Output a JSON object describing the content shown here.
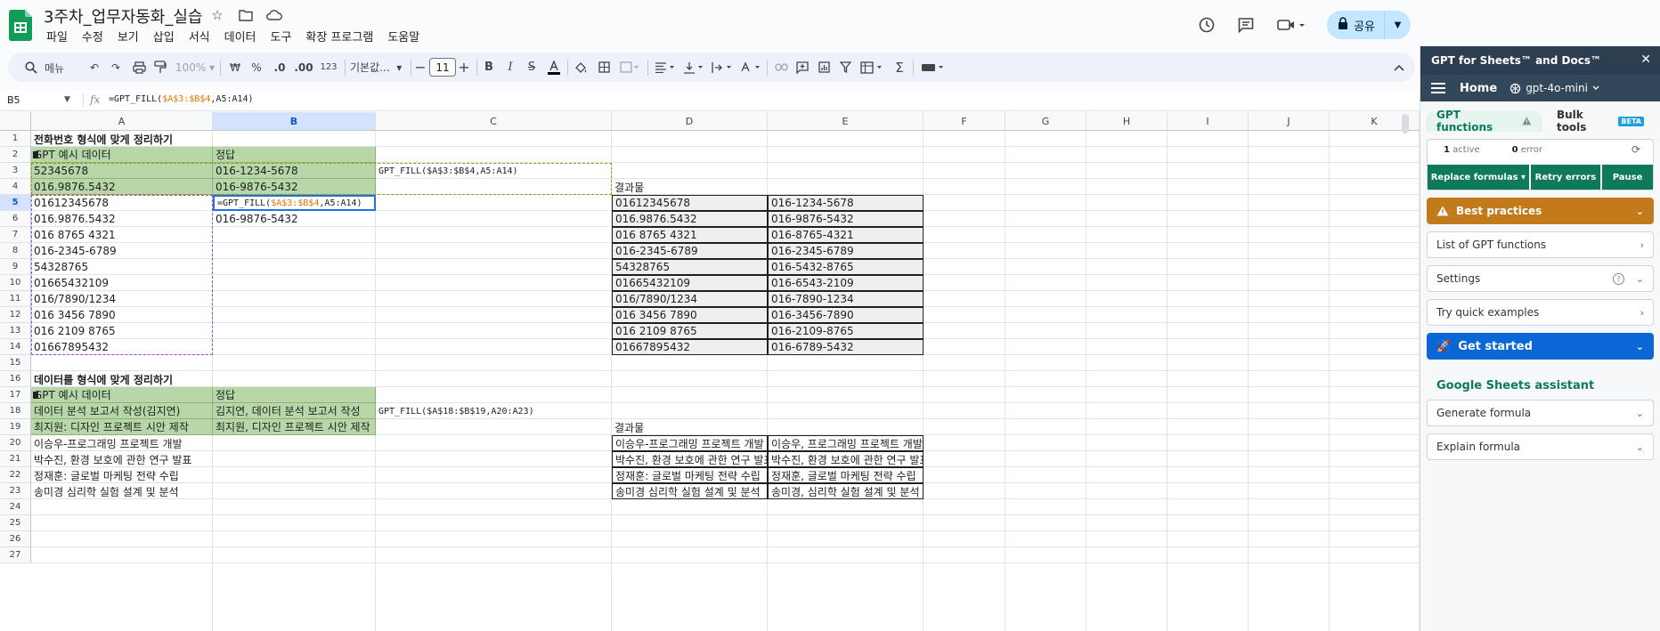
{
  "doc": {
    "title": "3주차_업무자동화_실습"
  },
  "menu": [
    "파일",
    "수정",
    "보기",
    "삽입",
    "서식",
    "데이터",
    "도구",
    "확장 프로그램",
    "도움말"
  ],
  "share": {
    "label": "공유"
  },
  "toolbar": {
    "menu_search": "메뉴",
    "zoom": "100%",
    "currency": "₩",
    "percent": "%",
    "dec_less": ".0",
    "dec_more": ".00",
    "num_format": "123",
    "font": "기본값...",
    "font_size": "11"
  },
  "formula_bar": {
    "cell_ref": "B5",
    "formula_prefix": "=GPT_FILL(",
    "formula_ref": "$A$3:$B$4",
    "formula_suffix": ",A5:A14)"
  },
  "columns": [
    "A",
    "B",
    "C",
    "D",
    "E",
    "F",
    "G",
    "H",
    "I",
    "J",
    "K"
  ],
  "rows": [
    "1",
    "2",
    "3",
    "4",
    "5",
    "6",
    "7",
    "8",
    "9",
    "10",
    "11",
    "12",
    "13",
    "14",
    "15",
    "16",
    "17",
    "18",
    "19",
    "20",
    "21",
    "22",
    "23",
    "24",
    "25",
    "26",
    "27"
  ],
  "section1": {
    "heading": "전화번호 형식에 맞게 정리하기",
    "col_a_header": "GPT 예시 데이터",
    "col_b_header": "정답",
    "examples": [
      [
        "52345678",
        "016-1234-5678"
      ],
      [
        "016.9876.5432",
        "016-9876-5432"
      ]
    ],
    "inputs": [
      "01612345678",
      "016.9876.5432",
      "016 8765 4321",
      "016-2345-6789",
      "54328765",
      "01665432109",
      "016/7890/1234",
      "016 3456 7890",
      "016 2109 8765",
      "01667895432"
    ],
    "b5_prefix": "=GPT_FILL(",
    "b5_ref": "$A$3:$B$4",
    "b5_suffix": ",A5:A14)",
    "b6": "016-9876-5432",
    "copied_formula": "GPT_FILL($A$3:$B$4,A5:A14)",
    "result_label": "결과물",
    "results": [
      [
        "01612345678",
        "016-1234-5678"
      ],
      [
        "016.9876.5432",
        "016-9876-5432"
      ],
      [
        "016 8765 4321",
        "016-8765-4321"
      ],
      [
        "016-2345-6789",
        "016-2345-6789"
      ],
      [
        "54328765",
        "016-5432-8765"
      ],
      [
        "01665432109",
        "016-6543-2109"
      ],
      [
        "016/7890/1234",
        "016-7890-1234"
      ],
      [
        "016 3456 7890",
        "016-3456-7890"
      ],
      [
        "016 2109 8765",
        "016-2109-8765"
      ],
      [
        "01667895432",
        "016-6789-5432"
      ]
    ]
  },
  "section2": {
    "heading": "데이터를 형식에 맞게 정리하기",
    "col_a_header": "GPT 예시 데이터",
    "col_b_header": "정답",
    "examples": [
      [
        "데이터 분석 보고서 작성(김지연)",
        "김지연, 데이터 분석 보고서 작성"
      ],
      [
        "최지원: 디자인 프로젝트 시안 제작",
        "최지원, 디자인 프로젝트 시안 제작"
      ]
    ],
    "inputs": [
      "이승우-프로그래밍 프로젝트 개발",
      "박수진, 환경 보호에 관한 연구 발표",
      "정재훈: 글로벌 마케팅 전략 수립",
      "송미경 심리학 실험 설계 및 분석"
    ],
    "copied_formula": "GPT_FILL($A$18:$B$19,A20:A23)",
    "result_label": "결과물",
    "results": [
      [
        "이승우-프로그래밍 프로젝트 개발",
        "이승우, 프로그래밍 프로젝트 개발"
      ],
      [
        "박수진, 환경 보호에 관한 연구 발표",
        "박수진, 환경 보호에 관한 연구 발표"
      ],
      [
        "정재훈: 글로벌 마케팅 전략 수립",
        "정재훈, 글로벌 마케팅 전략 수립"
      ],
      [
        "송미경 심리학 실험 설계 및 분석",
        "송미경, 심리학 실험 설계 및 분석"
      ]
    ]
  },
  "panel": {
    "title": "GPT for Sheets™ and Docs™",
    "nav_home": "Home",
    "model": "gpt-4o-mini",
    "tab_functions": "GPT functions",
    "tab_bulk": "Bulk tools",
    "beta": "BETA",
    "active_count": "1",
    "active_label": "active",
    "error_count": "0",
    "error_label": "error",
    "btn_replace": "Replace formulas",
    "btn_retry": "Retry errors",
    "btn_pause": "Pause",
    "best_practices": "Best practices",
    "list_functions": "List of GPT functions",
    "settings": "Settings",
    "quick_examples": "Try quick examples",
    "get_started": "Get started",
    "assistant_title": "Google Sheets assistant",
    "generate_formula": "Generate formula",
    "explain_formula": "Explain formula"
  }
}
